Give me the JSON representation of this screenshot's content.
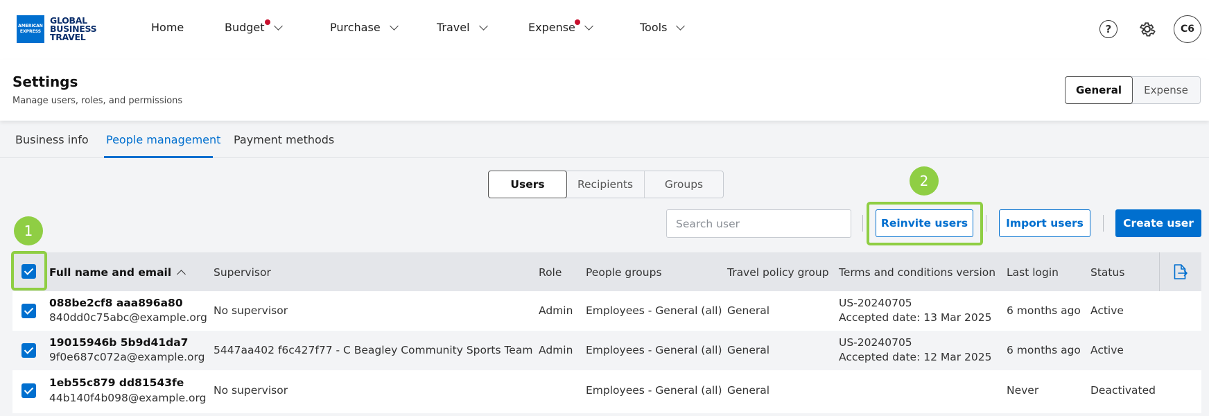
{
  "brand": {
    "logo_mark": "AMERICAN EXPRESS",
    "line1": "GLOBAL",
    "line2": "BUSINESS",
    "line3": "TRAVEL"
  },
  "nav": [
    {
      "label": "Home",
      "dropdown": false,
      "dot": false
    },
    {
      "label": "Budget",
      "dropdown": true,
      "dot": true
    },
    {
      "label": "Purchase",
      "dropdown": true,
      "dot": false
    },
    {
      "label": "Travel",
      "dropdown": true,
      "dot": false
    },
    {
      "label": "Expense",
      "dropdown": true,
      "dot": true
    },
    {
      "label": "Tools",
      "dropdown": true,
      "dot": false
    }
  ],
  "header_icons": {
    "help": "?",
    "settings": "gear-icon",
    "avatar": "C6"
  },
  "settings": {
    "title": "Settings",
    "subtitle": "Manage users, roles, and permissions",
    "toggle": [
      "General",
      "Expense"
    ],
    "toggle_selected": "General"
  },
  "tabs": [
    "Business info",
    "People management",
    "Payment methods"
  ],
  "active_tab": "People management",
  "subtabs": [
    "Users",
    "Recipients",
    "Groups"
  ],
  "active_subtab": "Users",
  "search": {
    "placeholder": "Search user"
  },
  "actions": {
    "reinvite": "Reinvite users",
    "import": "Import users",
    "create": "Create user"
  },
  "badges": {
    "one": "1",
    "two": "2"
  },
  "table": {
    "columns": [
      "Full name and email",
      "Supervisor",
      "Role",
      "People groups",
      "Travel policy group",
      "Terms and conditions version",
      "Last login",
      "Status"
    ],
    "rows": [
      {
        "name": "088be2cf8 aaa896a80",
        "email": "840dd0c75abc@example.org",
        "supervisor": "No supervisor",
        "role": "Admin",
        "groups": "Employees - General (all)",
        "policy": "General",
        "terms": "US-20240705",
        "accepted": "Accepted date: 13 Mar 2025",
        "last_login": "6 months ago",
        "status": "Active"
      },
      {
        "name": "19015946b 5b9d41da7",
        "email": "9f0e687c072a@example.org",
        "supervisor": "5447aa402 f6c427f77 - C Beagley Community Sports Team",
        "role": "Admin",
        "groups": "Employees - General (all)",
        "policy": "General",
        "terms": "US-20240705",
        "accepted": "Accepted date: 12 Mar 2025",
        "last_login": "6 months ago",
        "status": "Active"
      },
      {
        "name": "1eb55c879 dd81543fe",
        "email": "44b140f4b098@example.org",
        "supervisor": "No supervisor",
        "role": "",
        "groups": "Employees - General (all)",
        "policy": "General",
        "terms": "",
        "accepted": "",
        "last_login": "Never",
        "status": "Deactivated"
      }
    ]
  },
  "colors": {
    "accent": "#006fcf",
    "highlight": "#8fce44",
    "alert_dot": "#c8102e"
  }
}
